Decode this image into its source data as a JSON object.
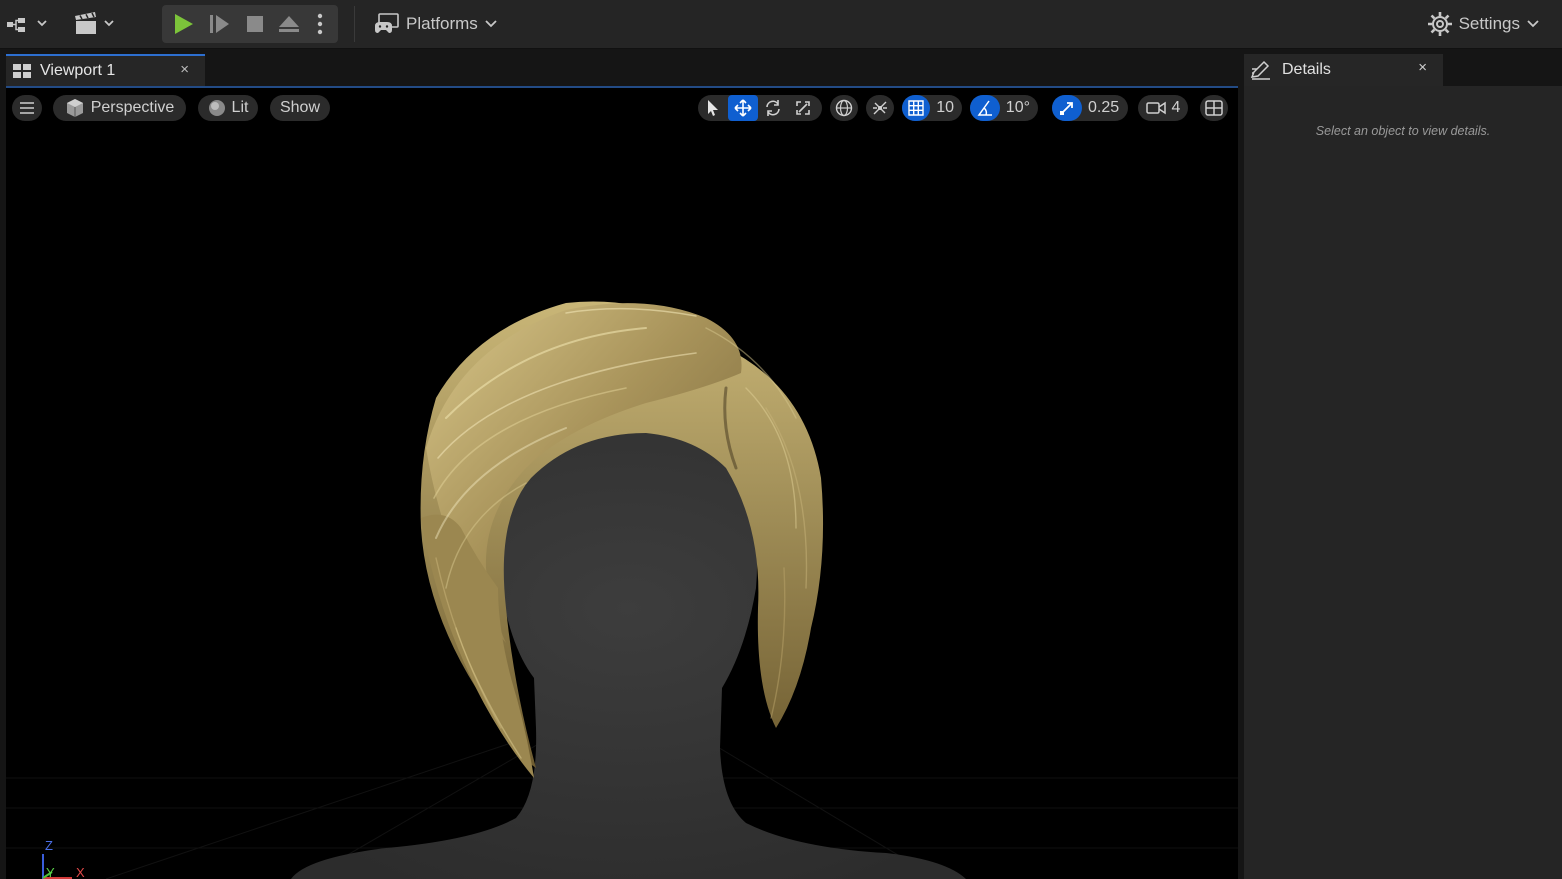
{
  "toolbar": {
    "platforms_label": "Platforms",
    "settings_label": "Settings",
    "play_color": "#7cc43a"
  },
  "viewport_tab": {
    "title": "Viewport 1",
    "close": "×",
    "accent": "#2d6fd0"
  },
  "viewport_toolbar": {
    "view_mode": "Perspective",
    "lighting": "Lit",
    "show": "Show",
    "grid_snap": "10",
    "rotation_snap": "10°",
    "scale_snap": "0.25",
    "camera_speed": "4"
  },
  "gizmo": {
    "z": "Z",
    "y": "Y",
    "x": "X"
  },
  "details": {
    "title": "Details",
    "close": "×",
    "empty_message": "Select an object to view details."
  },
  "icons": [
    "level-menu-icon",
    "cinematics-icon",
    "play-icon",
    "step-icon",
    "stop-icon",
    "eject-icon",
    "more-vertical-icon",
    "platforms-icon",
    "settings-gear-icon",
    "hamburger-icon",
    "perspective-cube-icon",
    "lit-sphere-icon",
    "select-arrow-icon",
    "translate-icon",
    "rotate-icon",
    "scale-icon",
    "world-local-icon",
    "surface-snap-icon",
    "grid-snap-icon",
    "rotation-snap-icon",
    "scale-snap-icon",
    "camera-speed-icon",
    "layout-icon",
    "details-pencil-icon"
  ]
}
